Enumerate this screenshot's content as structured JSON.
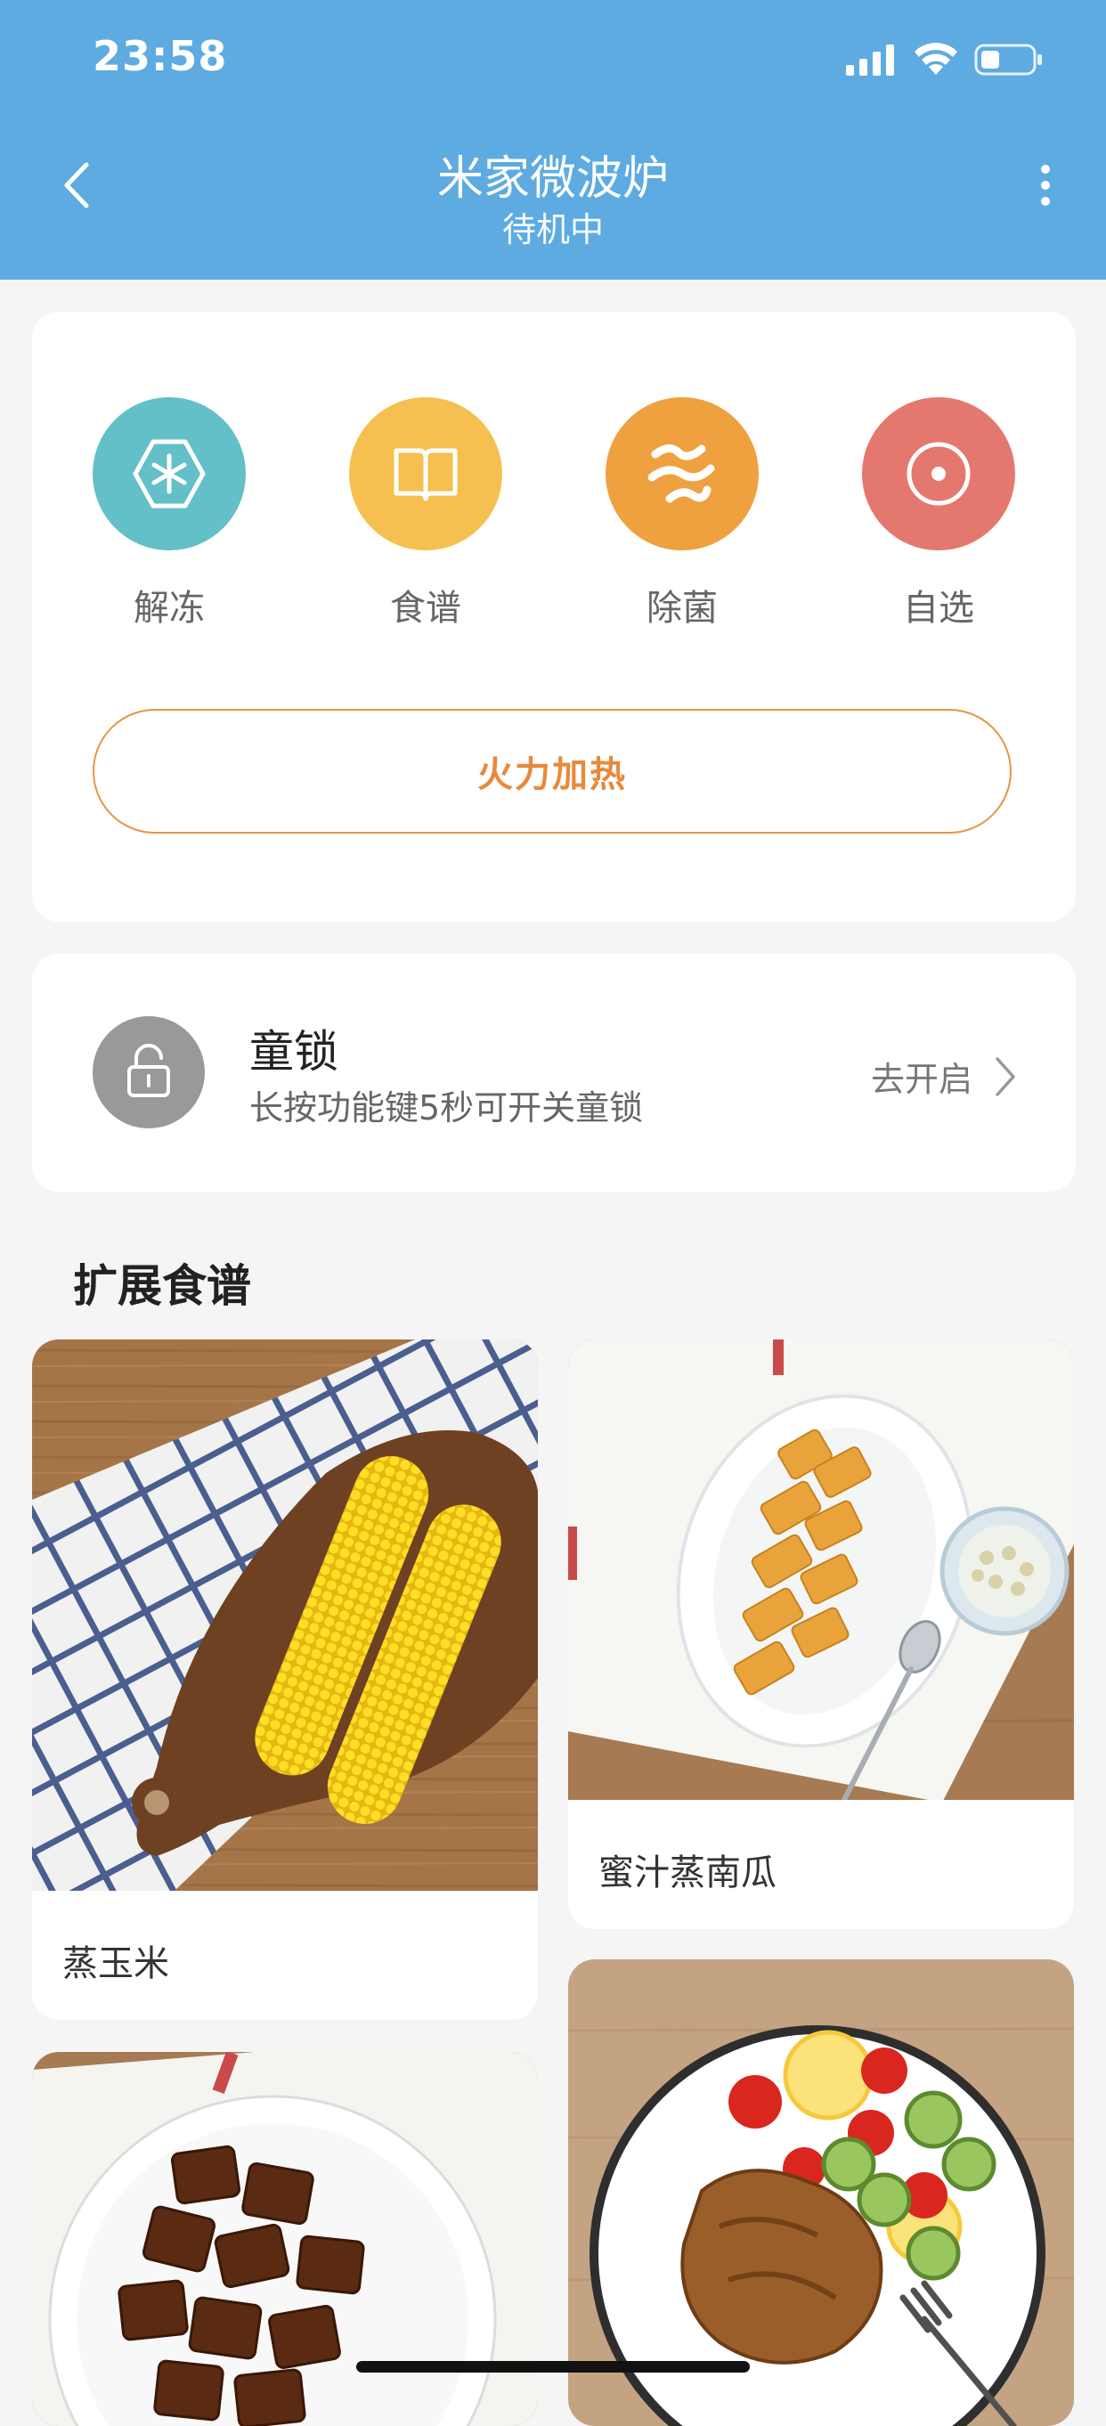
{
  "status_bar": {
    "time": "23:58"
  },
  "header": {
    "title": "米家微波炉",
    "subtitle": "待机中"
  },
  "modes": [
    {
      "label": "解冻",
      "icon": "defrost-icon",
      "color": "#63c0c9"
    },
    {
      "label": "食谱",
      "icon": "recipe-book-icon",
      "color": "#f5c04f"
    },
    {
      "label": "除菌",
      "icon": "sterilize-icon",
      "color": "#efa03f"
    },
    {
      "label": "自选",
      "icon": "custom-icon",
      "color": "#e5786e"
    }
  ],
  "heat_button": {
    "label": "火力加热"
  },
  "child_lock": {
    "title": "童锁",
    "description": "长按功能键5秒可开关童锁",
    "action": "去开启"
  },
  "section": {
    "title": "扩展食谱"
  },
  "recipes": [
    {
      "name": "蒸玉米"
    },
    {
      "name": "蜜汁蒸南瓜"
    },
    {
      "name": ""
    },
    {
      "name": ""
    }
  ],
  "colors": {
    "header": "#5dabe1",
    "accent": "#e8893a"
  }
}
